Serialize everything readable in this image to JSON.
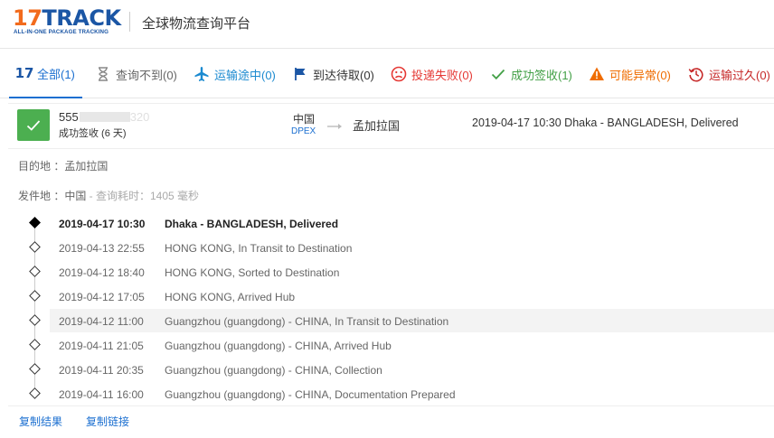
{
  "header": {
    "logo_17": "17",
    "logo_track": "TRACK",
    "logo_tagline": "ALL-IN-ONE PACKAGE TRACKING",
    "title": "全球物流查询平台"
  },
  "tabs": [
    {
      "label": "全部(1)",
      "color": "#1b6fd0",
      "icon": "17-logo-icon"
    },
    {
      "label": "查询不到(0)",
      "color": "#666666",
      "icon": "hourglass-icon"
    },
    {
      "label": "运输途中(0)",
      "color": "#1b8ad0",
      "icon": "airplane-icon"
    },
    {
      "label": "到达待取(0)",
      "color": "#333333",
      "icon": "flag-icon"
    },
    {
      "label": "投递失败(0)",
      "color": "#e53935",
      "icon": "sad-face-icon"
    },
    {
      "label": "成功签收(1)",
      "color": "#43a047",
      "icon": "checkmark-icon"
    },
    {
      "label": "可能异常(0)",
      "color": "#ef6c00",
      "icon": "warning-icon"
    },
    {
      "label": "运输过久(0)",
      "color": "#c62828",
      "icon": "clock-back-icon"
    }
  ],
  "package": {
    "tracking_prefix": "555",
    "tracking_suffix": "320",
    "status": "成功签收 (6 天)",
    "origin_country": "中国",
    "carrier": "DPEX",
    "destination_country": "孟加拉国",
    "latest_event": "2019-04-17 10:30  Dhaka - BANGLADESH, Delivered",
    "destination_line": "目的地 ：孟加拉国",
    "origin_line": "发件地 ：中国",
    "query_time": " - 查询耗时：1405 毫秒"
  },
  "events": [
    {
      "time": "2019-04-17 10:30",
      "desc": "Dhaka - BANGLADESH, Delivered"
    },
    {
      "time": "2019-04-13 22:55",
      "desc": "HONG KONG, In Transit to Destination"
    },
    {
      "time": "2019-04-12 18:40",
      "desc": "HONG KONG, Sorted to Destination"
    },
    {
      "time": "2019-04-12 17:05",
      "desc": "HONG KONG, Arrived Hub"
    },
    {
      "time": "2019-04-12 11:00",
      "desc": "Guangzhou (guangdong) - CHINA, In Transit to Destination"
    },
    {
      "time": "2019-04-11 21:05",
      "desc": "Guangzhou (guangdong) - CHINA, Arrived Hub"
    },
    {
      "time": "2019-04-11 20:35",
      "desc": "Guangzhou (guangdong) - CHINA, Collection"
    },
    {
      "time": "2019-04-11 16:00",
      "desc": "Guangzhou (guangdong) - CHINA, Documentation Prepared"
    }
  ],
  "footer": {
    "copy_result": "复制结果",
    "copy_link": "复制链接"
  }
}
